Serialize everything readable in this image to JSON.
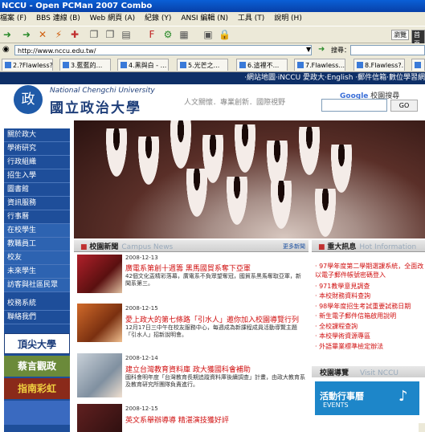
{
  "window": {
    "title": "NCCU - Open PCMan 2007 Combo"
  },
  "menu": [
    "檔案 (F)",
    "BBS 連線 (B)",
    "Web 網頁 (A)",
    "紀錄 (Y)",
    "ANSI 編輯 (N)",
    "工具 (T)",
    "說明 (H)"
  ],
  "toolbar": {
    "right_label1": "瀏覽",
    "right_label2": "首頁"
  },
  "address": {
    "url": "http://www.nccu.edu.tw/",
    "search_label": "搜尋："
  },
  "tabs": [
    "2.?Flawless?-",
    "3.藍藍的...",
    "4.黑與白 - ...",
    "5.光芒之...",
    "6.這裡不...",
    "7.Flawless...",
    "8.Flawless?..."
  ],
  "site": {
    "topnav": "‧網站地圖‧iNCCU 愛政大‧English ‧郵件信箱‧數位學習網",
    "logo_seal": "政",
    "logo_en": "National Chengchi University",
    "logo_zh": "國立政治大學",
    "slogan": "人文關懷．專業創新．國際視野",
    "google_label": "Google",
    "google_suffix": "校園搜尋",
    "go_label": "GO"
  },
  "sidebar": [
    "關於政大",
    "學術研究",
    "行政組織",
    "招生入學",
    "圖書館",
    "資訊服務",
    "行事曆",
    "在校學生",
    "教職員工",
    "校友",
    "未來學生",
    "訪客與社區民眾",
    "校務系統",
    "聯絡我們"
  ],
  "banners": [
    "頂尖大學",
    "蔡言觀政",
    "指南彩虹"
  ],
  "news": {
    "title": "校園新聞",
    "title_en": "Campus News",
    "more": "更多新聞",
    "items": [
      {
        "date": "2008-12-13",
        "title": "廣電系第創十週籌 黑馬國貿系奪下亞軍",
        "desc": "42個文化盃精彩落幕，廣電系不負眾望奪冠，國貿系黑馬奪取亞軍，新聞系第三。"
      },
      {
        "date": "2008-12-15",
        "title": "愛上政大的第七條路「引水人」邀你加入校園導覽行列",
        "desc": "12月17日三中午在校友服務中心，每週成為新課程成員活動導覽主題「引水人」招新說明會。"
      },
      {
        "date": "2008-12-14",
        "title": "建立台灣教育資料庫 政大獲國科會補助",
        "desc": "國科會明年度「台灣教育長期追蹤資料庫後續調查」計畫，由政大教育系及教育研究所團隊負責進行。"
      },
      {
        "date": "2008-12-15",
        "title": "英文系舉辦導導 精湛演技獲好評",
        "desc": ""
      }
    ]
  },
  "important": {
    "title": "重大訊息",
    "title_en": "Hot Information",
    "items": [
      "97學年度第二學期選課系統，全面改以電子郵件帳號密碼登入",
      "971教學意見調查",
      "本校財務資料查詢",
      "98學年度招生考試重要試務日期",
      "新生電子郵件信箱啟用說明",
      "全校課程查詢",
      "本校學術資源專區",
      "外語畢業標準檢定辦法"
    ]
  },
  "visit": {
    "title": "校園導覽",
    "title_en": "Visit NCCU",
    "events_zh": "活動行事曆",
    "events_en": "EVENTS"
  }
}
